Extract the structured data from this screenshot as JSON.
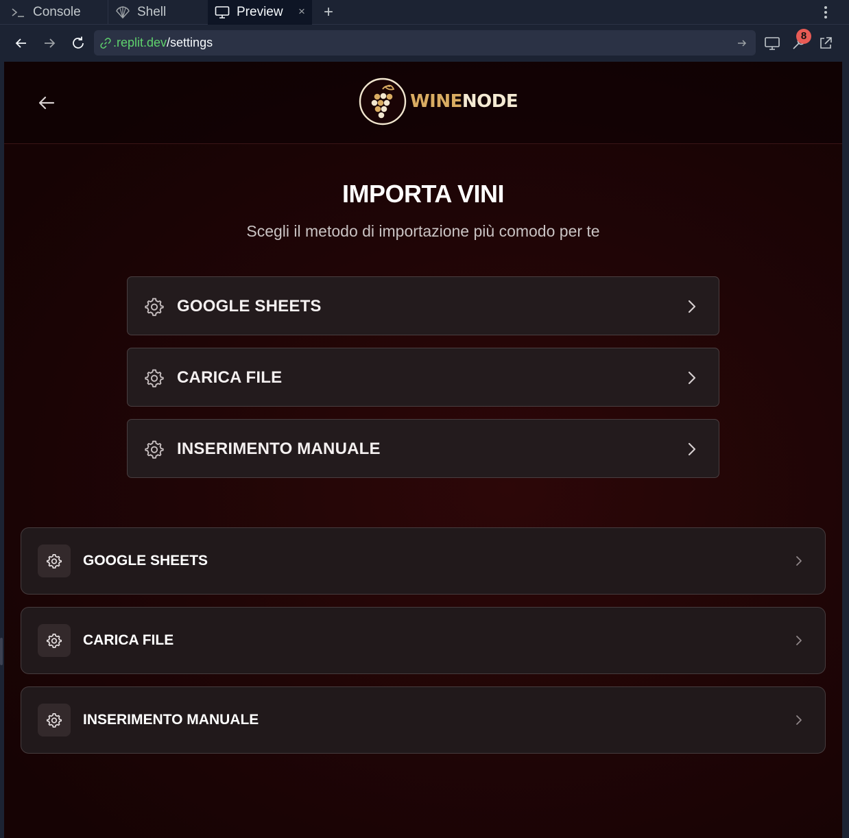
{
  "ide_tabs": {
    "console": "Console",
    "shell": "Shell",
    "preview": "Preview"
  },
  "browser": {
    "url_host": ".replit.dev",
    "url_path": "/settings",
    "devtools_badge": "8"
  },
  "app": {
    "logo_wine": "WINE",
    "logo_node": "NODE",
    "title": "IMPORTA VINI",
    "subtitle": "Scegli il metodo di importazione più comodo per te",
    "options": [
      {
        "label": "GOOGLE SHEETS",
        "icon": "gear-icon"
      },
      {
        "label": "CARICA FILE",
        "icon": "gear-icon"
      },
      {
        "label": "INSERIMENTO MANUALE",
        "icon": "gear-icon"
      }
    ],
    "options_secondary": [
      {
        "label": "GOOGLE SHEETS",
        "icon": "gear-icon"
      },
      {
        "label": "CARICA FILE",
        "icon": "gear-icon"
      },
      {
        "label": "INSERIMENTO MANUALE",
        "icon": "gear-icon"
      }
    ]
  },
  "colors": {
    "ide_bg": "#1c2333",
    "accent_gold": "#d9ac62",
    "app_bg": "#1f0506",
    "url_host": "#5fd36d",
    "badge": "#e85b55"
  }
}
